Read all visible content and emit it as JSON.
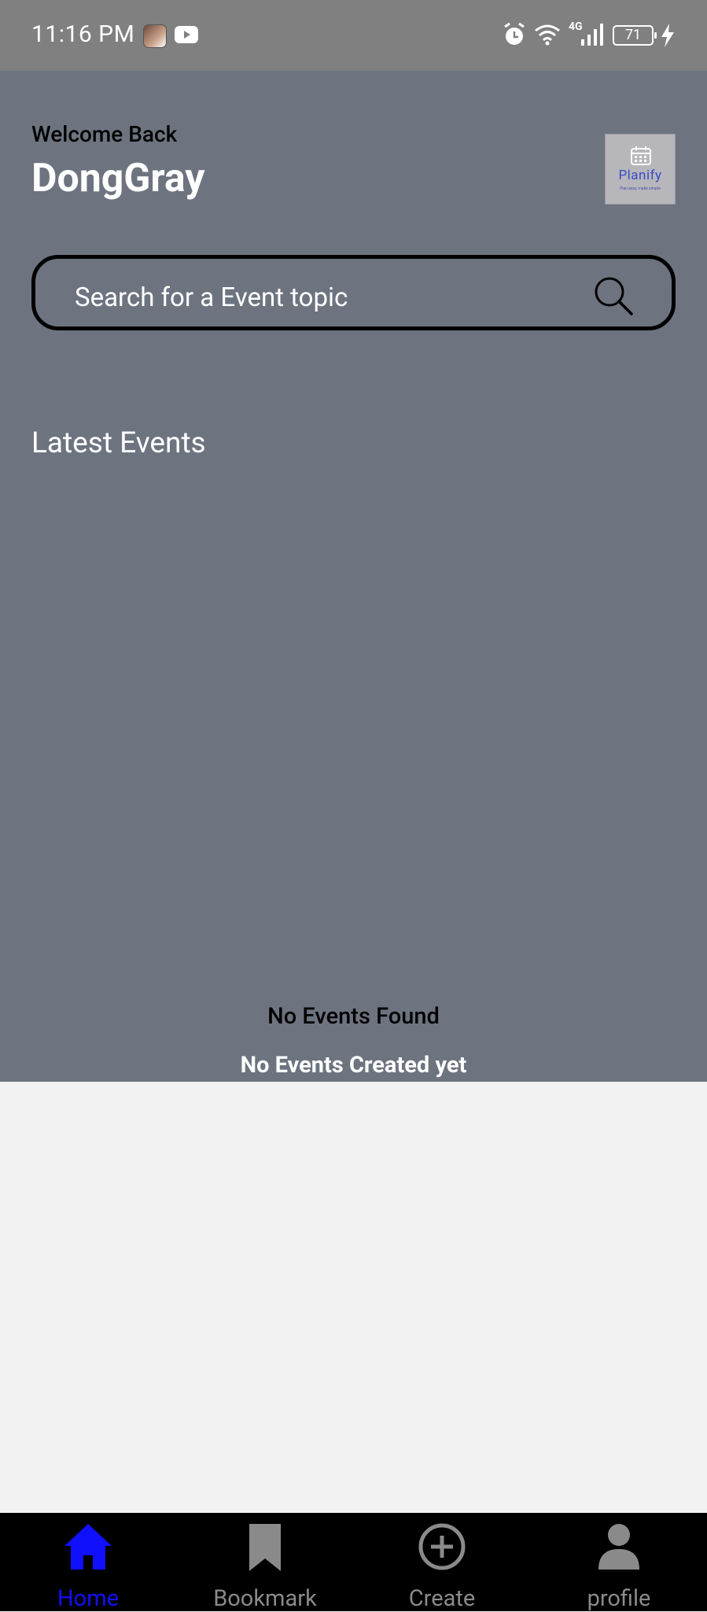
{
  "status_bar": {
    "time": "11:16 PM",
    "battery_level": "71",
    "network_label": "4G",
    "icons": [
      "avatar-thumbnail",
      "youtube-icon",
      "alarm-icon",
      "wifi-icon",
      "signal-icon",
      "battery-icon",
      "charging-icon"
    ]
  },
  "header": {
    "welcome_text": "Welcome Back",
    "username": "DongGray",
    "logo": {
      "name": "Planify",
      "tagline": "Plan easy, make simple"
    }
  },
  "search": {
    "placeholder": "Search for a Event topic"
  },
  "latest_events": {
    "title": "Latest Events",
    "empty_title": "No Events Found",
    "empty_subtitle": "No Events Created yet"
  },
  "bottom_nav": {
    "items": [
      {
        "label": "Home",
        "icon": "home-icon",
        "active": true
      },
      {
        "label": "Bookmark",
        "icon": "bookmark-icon",
        "active": false
      },
      {
        "label": "Create",
        "icon": "add-circle-icon",
        "active": false
      },
      {
        "label": "profile",
        "icon": "person-icon",
        "active": false
      }
    ]
  },
  "colors": {
    "status_bar_bg": "#808080",
    "hero_bg": "#6d7480",
    "page_bg": "#f2f2f2",
    "nav_bg": "#000000",
    "nav_active": "#1010ff",
    "nav_inactive": "#8a8a8a"
  }
}
